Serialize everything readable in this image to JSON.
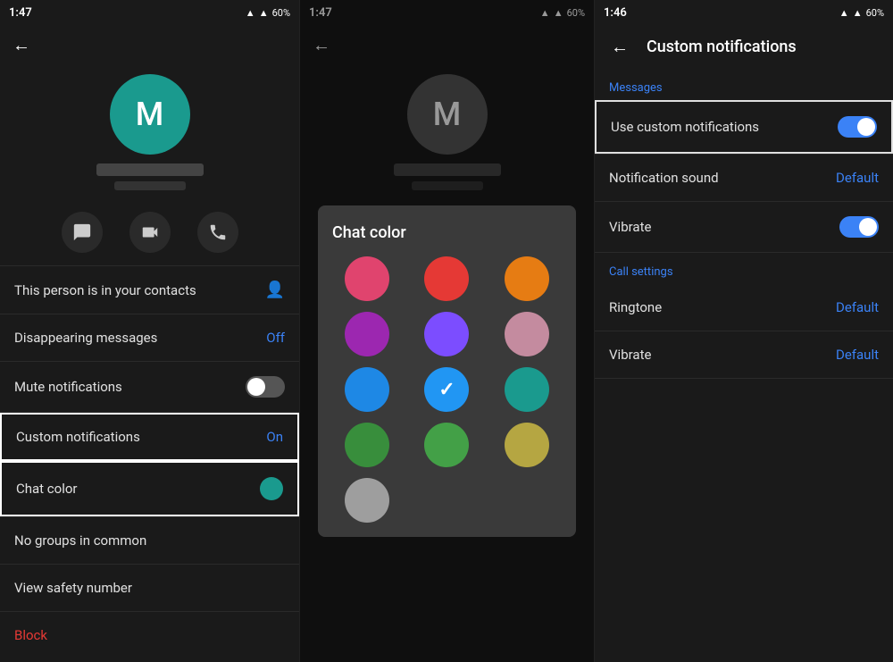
{
  "panel1": {
    "statusBar": {
      "time": "1:47",
      "battery": "60%"
    },
    "avatar": {
      "letter": "M",
      "color": "#1a9a8e"
    },
    "items": [
      {
        "label": "This person is in your contacts",
        "value": "",
        "type": "icon"
      },
      {
        "label": "Disappearing messages",
        "value": "Off",
        "type": "value"
      },
      {
        "label": "Mute notifications",
        "value": "",
        "type": "toggle-off"
      },
      {
        "label": "Custom notifications",
        "value": "On",
        "type": "outlined-value"
      },
      {
        "label": "Chat color",
        "value": "",
        "type": "outlined-dot"
      },
      {
        "label": "No groups in common",
        "value": "",
        "type": "static"
      },
      {
        "label": "View safety number",
        "value": "",
        "type": "static"
      },
      {
        "label": "Block",
        "value": "",
        "type": "red"
      }
    ]
  },
  "panel2": {
    "statusBar": {
      "time": "1:47",
      "battery": "60%"
    },
    "avatar": {
      "letter": "M",
      "color": "#555"
    },
    "colorPicker": {
      "title": "Chat color",
      "colors": [
        {
          "hex": "#e0446e",
          "selected": false
        },
        {
          "hex": "#e53935",
          "selected": false
        },
        {
          "hex": "#e67c13",
          "selected": false
        },
        {
          "hex": "#9c27b0",
          "selected": false
        },
        {
          "hex": "#7c4dff",
          "selected": false
        },
        {
          "hex": "#c48b9f",
          "selected": false
        },
        {
          "hex": "#1e88e5",
          "selected": false
        },
        {
          "hex": "#2196f3",
          "selected": true
        },
        {
          "hex": "#1a9a8e",
          "selected": false
        },
        {
          "hex": "#388e3c",
          "selected": false
        },
        {
          "hex": "#43a047",
          "selected": false
        },
        {
          "hex": "#b5a642",
          "selected": false
        },
        {
          "hex": "#9e9e9e",
          "selected": false
        }
      ]
    }
  },
  "panel3": {
    "statusBar": {
      "time": "1:46",
      "battery": "60%"
    },
    "title": "Custom notifications",
    "messagesLabel": "Messages",
    "useCustom": {
      "label": "Use custom notifications",
      "enabled": true
    },
    "notificationSound": {
      "label": "Notification sound",
      "value": "Default"
    },
    "vibrate1": {
      "label": "Vibrate",
      "enabled": true
    },
    "callSettingsLabel": "Call settings",
    "ringtone": {
      "label": "Ringtone",
      "value": "Default"
    },
    "vibrate2": {
      "label": "Vibrate",
      "value": "Default"
    }
  }
}
